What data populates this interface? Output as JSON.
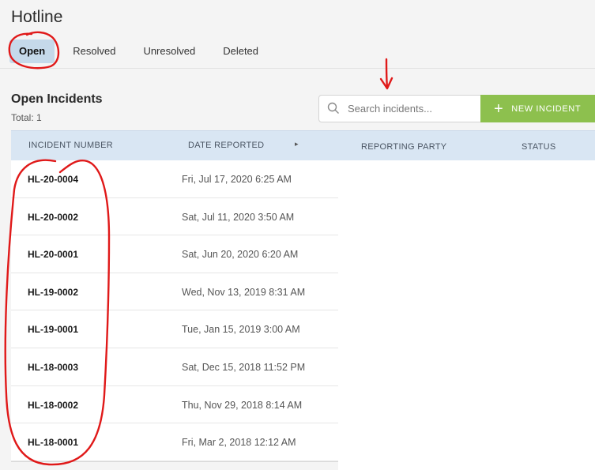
{
  "page": {
    "title": "Hotline"
  },
  "tabs": [
    {
      "label": "Open",
      "active": true
    },
    {
      "label": "Resolved",
      "active": false
    },
    {
      "label": "Unresolved",
      "active": false
    },
    {
      "label": "Deleted",
      "active": false
    }
  ],
  "section": {
    "title": "Open Incidents",
    "total": "Total: 1"
  },
  "search": {
    "placeholder": "Search incidents...",
    "value": ""
  },
  "new_incident": {
    "label": "NEW INCIDENT"
  },
  "columns": {
    "incident_number": "INCIDENT NUMBER",
    "date_reported": "DATE REPORTED",
    "reporting_party": "REPORTING PARTY",
    "status": "STATUS"
  },
  "rows": [
    {
      "number": "HL-20-0004",
      "date": "Fri, Jul 17, 2020 6:25 AM"
    },
    {
      "number": "HL-20-0002",
      "date": "Sat, Jul 11, 2020 3:50 AM"
    },
    {
      "number": "HL-20-0001",
      "date": "Sat, Jun 20, 2020 6:20 AM"
    },
    {
      "number": "HL-19-0002",
      "date": "Wed, Nov 13, 2019 8:31 AM"
    },
    {
      "number": "HL-19-0001",
      "date": "Tue, Jan 15, 2019 3:00 AM"
    },
    {
      "number": "HL-18-0003",
      "date": "Sat, Dec 15, 2018 11:52 PM"
    },
    {
      "number": "HL-18-0002",
      "date": "Thu, Nov 29, 2018 8:14 AM"
    },
    {
      "number": "HL-18-0001",
      "date": "Fri, Mar 2, 2018 12:12 AM"
    }
  ],
  "colors": {
    "accent_green": "#8dc04e",
    "active_tab": "#c5d9ea",
    "header_blue": "#d9e6f3",
    "annotation_red": "#e01919"
  },
  "icons": {
    "search": "search-icon",
    "plus": "plus-icon",
    "more": "chevron-right-icon"
  }
}
